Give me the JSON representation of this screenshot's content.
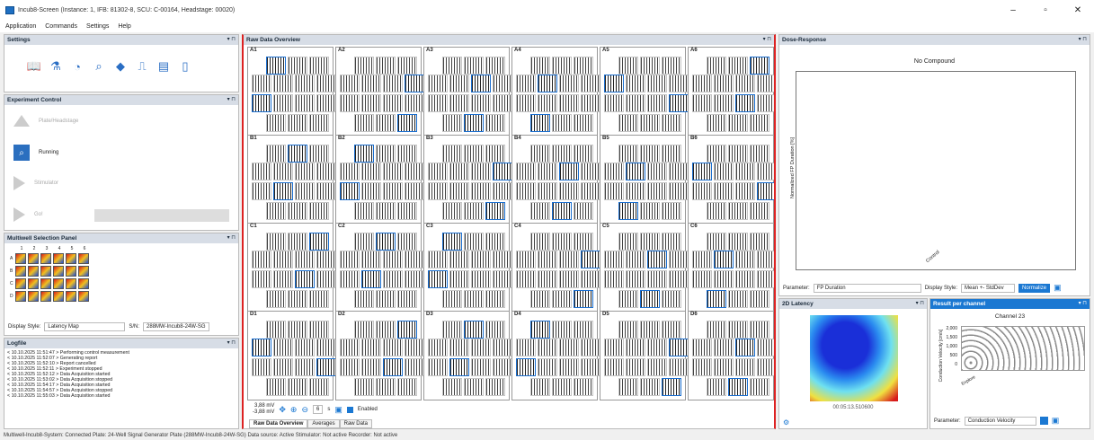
{
  "window": {
    "title": "Incub8-Screen (Instance: 1, IFB: 81302-8, SCU: C-00164, Headstage: 00020)",
    "minimize": "–",
    "maximize": "▫",
    "close": "✕"
  },
  "menu": [
    "Application",
    "Commands",
    "Settings",
    "Help"
  ],
  "panels": {
    "settings": "Settings",
    "experiment": "Experiment Control",
    "multiwell": "Multiwell Selection Panel",
    "logfile": "Logfile",
    "raw": "Raw Data Overview",
    "dose": "Dose-Response",
    "latency": "2D Latency",
    "result": "Result per channel"
  },
  "experiment": {
    "plate": "Plate/Headstage",
    "running": "Running",
    "stimulator": "Stimulator",
    "go": "Go!"
  },
  "multiwell": {
    "cols": [
      "1",
      "2",
      "3",
      "4",
      "5",
      "6"
    ],
    "rows": [
      "A",
      "B",
      "C",
      "D"
    ],
    "display_label": "Display Style:",
    "display_value": "Latency Map",
    "sn_label": "S/N:",
    "sn_value": "288MW-Incub8-24W-SG"
  },
  "log": [
    "< 10.10.2025 11:51:47 > Performing control measurement",
    "< 10.10.2025 11:52:07 > Generating report",
    "< 10.10.2025 11:52:10 > Report cancelled",
    "< 10.10.2025 11:52:11 > Experiment stopped",
    "< 10.10.2025 11:52:12 > Data Acquisition started",
    "< 10.10.2025 11:53:02 > Data Acquisition stopped",
    "< 10.10.2025 11:54:17 > Data Acquisition started",
    "< 10.10.2025 11:54:57 > Data Acquisition stopped",
    "< 10.10.2025 11:55:03 > Data Acquisition started"
  ],
  "wells": [
    "A1",
    "A2",
    "A3",
    "A4",
    "A5",
    "A6",
    "B1",
    "B2",
    "B3",
    "B4",
    "B5",
    "B6",
    "C1",
    "C2",
    "C3",
    "C4",
    "C5",
    "C6",
    "D1",
    "D2",
    "D3",
    "D4",
    "D5",
    "D6"
  ],
  "raw": {
    "mv_top": "3,88 mV",
    "mv_bottom": "-3,88 mV",
    "seconds": "6",
    "sec_unit": "s",
    "enabled": "Enabled",
    "tabs": [
      "Raw Data Overview",
      "Averages",
      "Raw Data"
    ]
  },
  "dose": {
    "title": "No Compound",
    "ylabel": "Normalized FP Duration [%]",
    "xtick": "Control",
    "param_label": "Parameter:",
    "param_value": "FP Duration",
    "style_label": "Display Style:",
    "style_value": "Mean +- StdDev",
    "normalize": "Normalize"
  },
  "latency": {
    "time": "00:05:13.510600"
  },
  "result": {
    "title": "Channel 23",
    "ylabel": "Conduction Velocity [cm/s]",
    "yticks": [
      "2,000",
      "1,500",
      "1,000",
      "500",
      "0"
    ],
    "xtick": "Explore",
    "param_label": "Parameter:",
    "param_value": "Conduction Velocity"
  },
  "status": "Multiwell-Incub8-System: Connected   Plate: 24-Well Signal Generator Plate (288MW-Incub8-24W-SG)   Data source: Active   Stimulator: Not active   Recorder: Not active"
}
